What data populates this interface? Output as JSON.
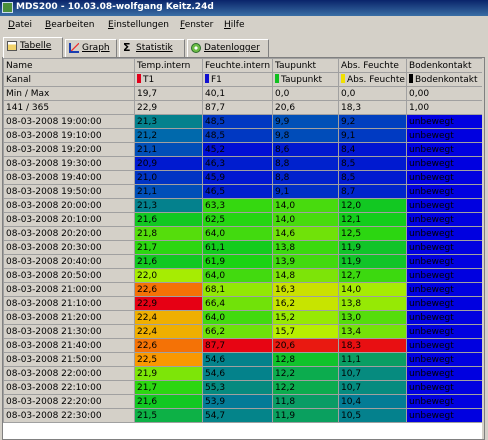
{
  "window": {
    "title": "MDS200 - 10.03.08-wolfgang Keitz.24d"
  },
  "menu": [
    "Datei",
    "Bearbeiten",
    "Einstellungen",
    "Fenster",
    "Hilfe"
  ],
  "tabs": [
    {
      "label": "Tabelle",
      "icon": "table-icon"
    },
    {
      "label": "Graph",
      "icon": "graph-icon"
    },
    {
      "label": "Statistik",
      "icon": "sigma-icon"
    },
    {
      "label": "Datenlogger",
      "icon": "logger-icon"
    }
  ],
  "table": {
    "columns": [
      "Name",
      "Temp.intern",
      "Feuchte.intern",
      "Taupunkt",
      "Abs. Feuchte",
      "Bodenkontakt"
    ],
    "kanal_label": "Kanal",
    "channels": [
      {
        "label": "T1",
        "color": "#e0001a"
      },
      {
        "label": "F1",
        "color": "#1010d0"
      },
      {
        "label": "Taupunkt",
        "color": "#10c020"
      },
      {
        "label": "Abs. Feuchte",
        "color": "#f0e000"
      },
      {
        "label": "Bodenkontakt",
        "color": "#000000"
      }
    ],
    "minmax": {
      "label": "Min / Max",
      "values": [
        "19,7",
        "40,1",
        "0,0",
        "0,0",
        "0,00"
      ]
    },
    "count": {
      "label": "141 / 365",
      "values": [
        "22,9",
        "87,7",
        "20,6",
        "18,3",
        "1,00"
      ]
    },
    "rows": [
      {
        "time": "08-03-2008 19:00:00",
        "t": "21,3",
        "f": "48,5",
        "tp": "9,9",
        "af": "9,2",
        "bk": "unbewegt"
      },
      {
        "time": "08-03-2008 19:10:00",
        "t": "21,2",
        "f": "48,5",
        "tp": "9,8",
        "af": "9,1",
        "bk": "unbewegt"
      },
      {
        "time": "08-03-2008 19:20:00",
        "t": "21,1",
        "f": "45,2",
        "tp": "8,6",
        "af": "8,4",
        "bk": "unbewegt"
      },
      {
        "time": "08-03-2008 19:30:00",
        "t": "20,9",
        "f": "46,3",
        "tp": "8,8",
        "af": "8,5",
        "bk": "unbewegt"
      },
      {
        "time": "08-03-2008 19:40:00",
        "t": "21,0",
        "f": "45,9",
        "tp": "8,8",
        "af": "8,5",
        "bk": "unbewegt"
      },
      {
        "time": "08-03-2008 19:50:00",
        "t": "21,1",
        "f": "46,5",
        "tp": "9,1",
        "af": "8,7",
        "bk": "unbewegt"
      },
      {
        "time": "08-03-2008 20:00:00",
        "t": "21,3",
        "f": "63,3",
        "tp": "14,0",
        "af": "12,0",
        "bk": "unbewegt"
      },
      {
        "time": "08-03-2008 20:10:00",
        "t": "21,6",
        "f": "62,5",
        "tp": "14,0",
        "af": "12,1",
        "bk": "unbewegt"
      },
      {
        "time": "08-03-2008 20:20:00",
        "t": "21,8",
        "f": "64,0",
        "tp": "14,6",
        "af": "12,5",
        "bk": "unbewegt"
      },
      {
        "time": "08-03-2008 20:30:00",
        "t": "21,7",
        "f": "61,1",
        "tp": "13,8",
        "af": "11,9",
        "bk": "unbewegt"
      },
      {
        "time": "08-03-2008 20:40:00",
        "t": "21,6",
        "f": "61,9",
        "tp": "13,9",
        "af": "11,9",
        "bk": "unbewegt"
      },
      {
        "time": "08-03-2008 20:50:00",
        "t": "22,0",
        "f": "64,0",
        "tp": "14,8",
        "af": "12,7",
        "bk": "unbewegt"
      },
      {
        "time": "08-03-2008 21:00:00",
        "t": "22,6",
        "f": "68,1",
        "tp": "16,3",
        "af": "14,0",
        "bk": "unbewegt"
      },
      {
        "time": "08-03-2008 21:10:00",
        "t": "22,9",
        "f": "66,4",
        "tp": "16,2",
        "af": "13,8",
        "bk": "unbewegt"
      },
      {
        "time": "08-03-2008 21:20:00",
        "t": "22,4",
        "f": "64,0",
        "tp": "15,2",
        "af": "13,0",
        "bk": "unbewegt"
      },
      {
        "time": "08-03-2008 21:30:00",
        "t": "22,4",
        "f": "66,2",
        "tp": "15,7",
        "af": "13,4",
        "bk": "unbewegt"
      },
      {
        "time": "08-03-2008 21:40:00",
        "t": "22,6",
        "f": "87,7",
        "tp": "20,6",
        "af": "18,3",
        "bk": "unbewegt"
      },
      {
        "time": "08-03-2008 21:50:00",
        "t": "22,5",
        "f": "54,6",
        "tp": "12,8",
        "af": "11,1",
        "bk": "unbewegt"
      },
      {
        "time": "08-03-2008 22:00:00",
        "t": "21,9",
        "f": "54,6",
        "tp": "12,2",
        "af": "10,7",
        "bk": "unbewegt"
      },
      {
        "time": "08-03-2008 22:10:00",
        "t": "21,7",
        "f": "55,3",
        "tp": "12,2",
        "af": "10,7",
        "bk": "unbewegt"
      },
      {
        "time": "08-03-2008 22:20:00",
        "t": "21,6",
        "f": "53,9",
        "tp": "11,8",
        "af": "10,4",
        "bk": "unbewegt"
      },
      {
        "time": "08-03-2008 22:30:00",
        "t": "21,5",
        "f": "54,7",
        "tp": "11,9",
        "af": "10,5",
        "bk": "unbewegt"
      }
    ]
  }
}
